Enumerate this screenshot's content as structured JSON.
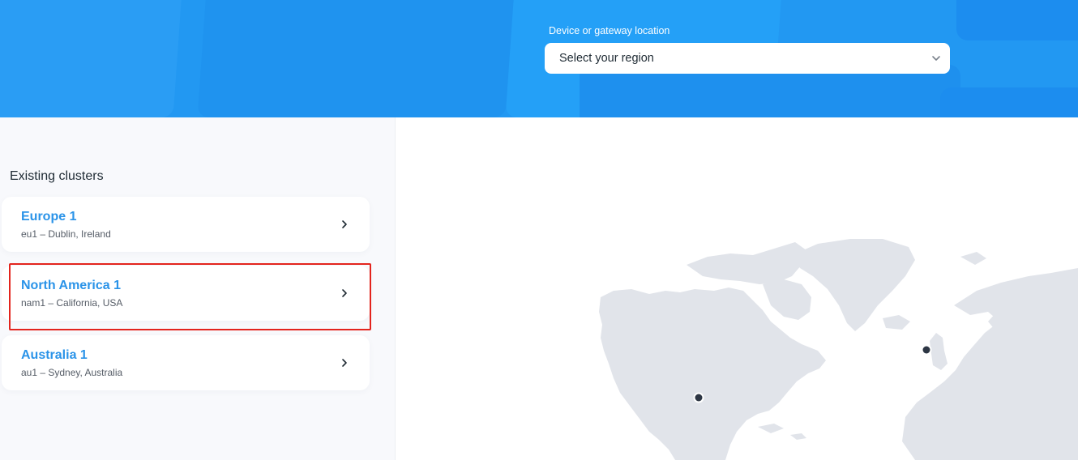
{
  "header": {
    "region_label": "Device or gateway location",
    "region_select": {
      "value": "Select your region",
      "icon": "chevron-down-icon"
    }
  },
  "clusters": {
    "title": "Existing clusters",
    "items": [
      {
        "name": "Europe 1",
        "location": "eu1 – Dublin, Ireland",
        "icon": "chevron-right-icon"
      },
      {
        "name": "North America 1",
        "location": "nam1 – California, USA",
        "icon": "chevron-right-icon",
        "highlighted": true
      },
      {
        "name": "Australia 1",
        "location": "au1 – Sydney, Australia",
        "icon": "chevron-right-icon"
      }
    ]
  },
  "map": {
    "markers": [
      "Dublin, Ireland",
      "California, USA"
    ]
  },
  "colors": {
    "header_bg": "#2298f2",
    "cluster_name": "#2a93e8",
    "highlight_border": "#e3241d",
    "land": "#e1e4ea",
    "marker": "#2d3644"
  }
}
